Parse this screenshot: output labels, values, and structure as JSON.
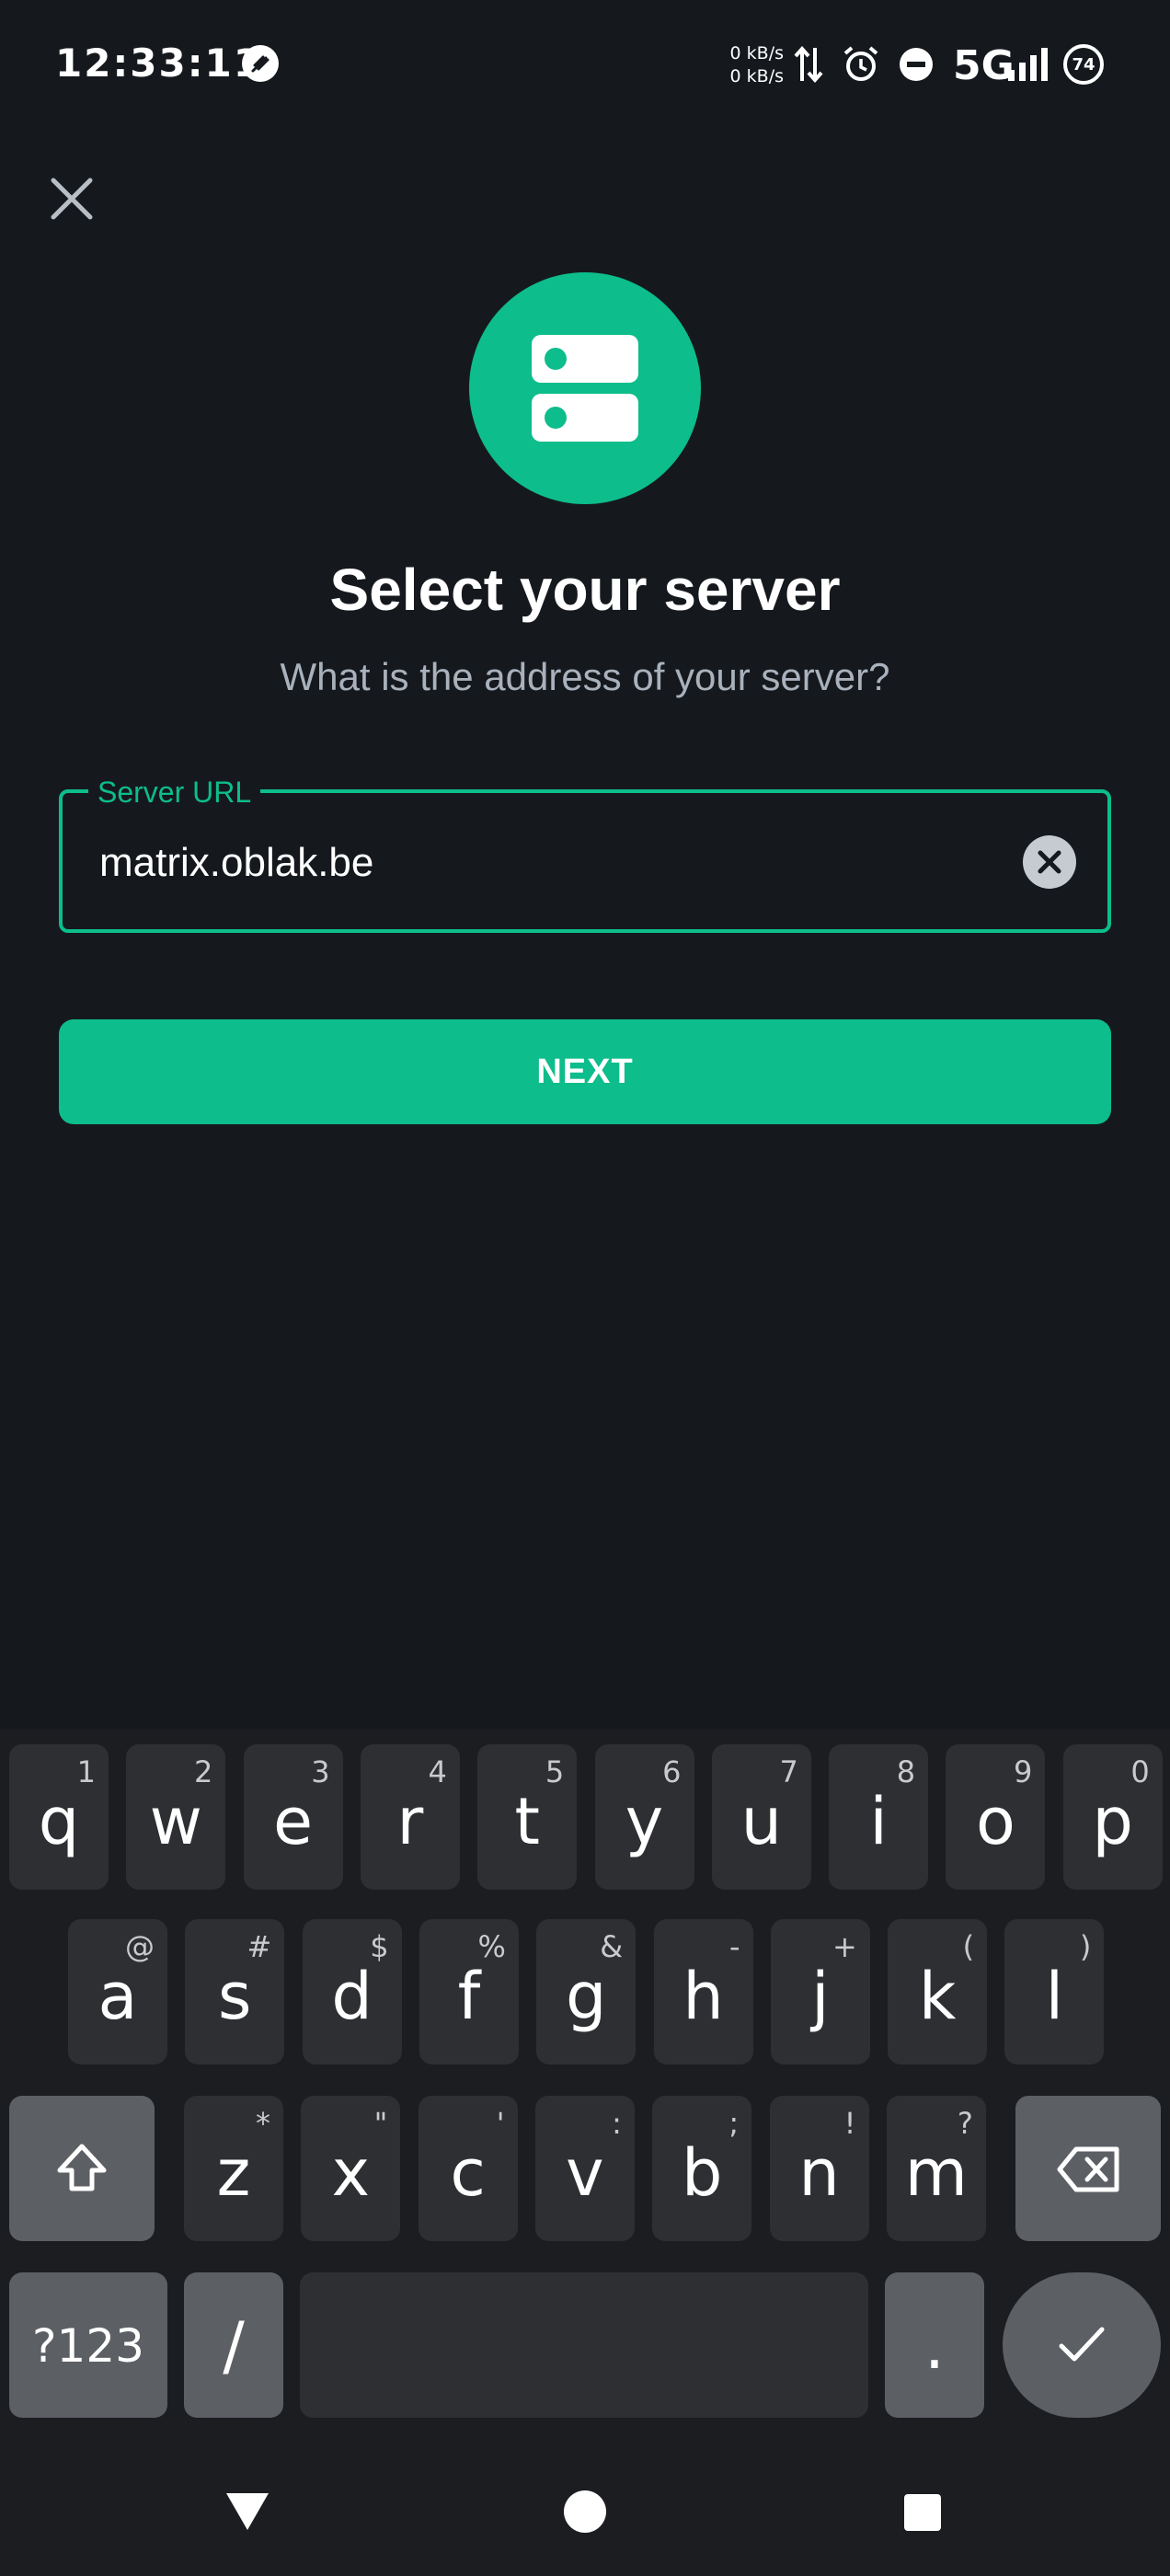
{
  "status_bar": {
    "time": "12:33:11",
    "speed_up": "0 kB/s",
    "speed_down": "0 kB/s",
    "network": "5G",
    "battery": "74"
  },
  "screen": {
    "title": "Select your server",
    "subtitle": "What is the address of your server?",
    "server_field": {
      "label": "Server URL",
      "value": "matrix.oblak.be"
    },
    "next_label": "NEXT"
  },
  "keyboard": {
    "row1": [
      {
        "key": "q",
        "hint": "1"
      },
      {
        "key": "w",
        "hint": "2"
      },
      {
        "key": "e",
        "hint": "3"
      },
      {
        "key": "r",
        "hint": "4"
      },
      {
        "key": "t",
        "hint": "5"
      },
      {
        "key": "y",
        "hint": "6"
      },
      {
        "key": "u",
        "hint": "7"
      },
      {
        "key": "i",
        "hint": "8"
      },
      {
        "key": "o",
        "hint": "9"
      },
      {
        "key": "p",
        "hint": "0"
      }
    ],
    "row2": [
      {
        "key": "a",
        "hint": "@"
      },
      {
        "key": "s",
        "hint": "#"
      },
      {
        "key": "d",
        "hint": "$"
      },
      {
        "key": "f",
        "hint": "%"
      },
      {
        "key": "g",
        "hint": "&"
      },
      {
        "key": "h",
        "hint": "-"
      },
      {
        "key": "j",
        "hint": "+"
      },
      {
        "key": "k",
        "hint": "("
      },
      {
        "key": "l",
        "hint": ")"
      }
    ],
    "row3": [
      {
        "key": "z",
        "hint": "*"
      },
      {
        "key": "x",
        "hint": "\""
      },
      {
        "key": "c",
        "hint": "'"
      },
      {
        "key": "v",
        "hint": ":"
      },
      {
        "key": "b",
        "hint": ";"
      },
      {
        "key": "n",
        "hint": "!"
      },
      {
        "key": "m",
        "hint": "?"
      }
    ],
    "symbols_label": "?123",
    "slash_label": "/",
    "period_label": "."
  },
  "icons": {
    "close": "close-icon",
    "server": "server-icon",
    "clear": "clear-circle-icon",
    "shift": "shift-icon",
    "backspace": "backspace-icon",
    "done": "checkmark-icon",
    "nav_back": "triangle-back-icon",
    "nav_home": "circle-home-icon",
    "nav_recents": "square-recents-icon"
  },
  "colors": {
    "accent": "#0dbd8b",
    "background": "#15191e",
    "subtitle": "#a9b2bc"
  }
}
